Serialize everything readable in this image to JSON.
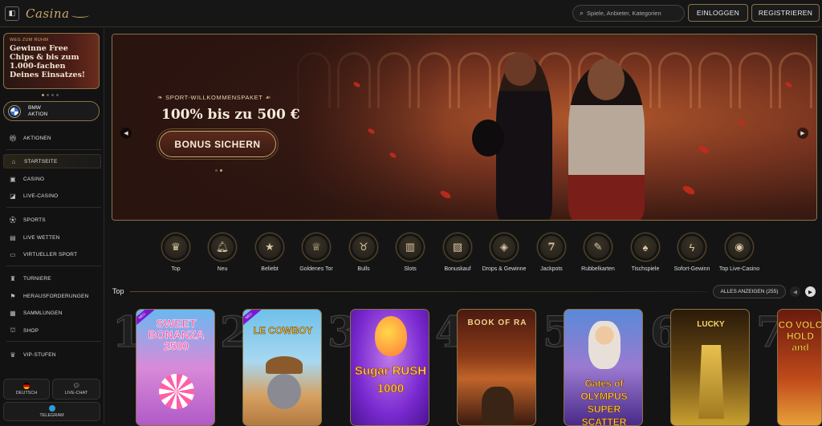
{
  "header": {
    "logo": "Casina",
    "search_placeholder": "Spiele, Anbieter, Kategorien",
    "login_label": "EINLOGGEN",
    "register_label": "REGISTRIEREN"
  },
  "sidebar": {
    "promo": {
      "kicker": "WEG ZUM RUHM",
      "title": "Gewinne Free Chips & bis zum 1.000-fachen Deines Einsatzes!"
    },
    "bmw": {
      "line1": "BMW",
      "line2": "AKTION"
    },
    "items": [
      {
        "label": "AKTIONEN",
        "icon": "gift-icon"
      },
      {
        "label": "STARTSEITE",
        "icon": "home-icon"
      },
      {
        "label": "CASINO",
        "icon": "casino-icon"
      },
      {
        "label": "LIVE-CASINO",
        "icon": "live-casino-icon"
      },
      {
        "label": "SPORTS",
        "icon": "soccer-ball-icon"
      },
      {
        "label": "LIVE WETTEN",
        "icon": "live-bets-icon"
      },
      {
        "label": "VIRTUELLER SPORT",
        "icon": "virtual-sport-icon"
      },
      {
        "label": "TURNIERE",
        "icon": "tournament-icon"
      },
      {
        "label": "HERAUSFORDERUNGEN",
        "icon": "challenge-icon"
      },
      {
        "label": "SAMMLUNGEN",
        "icon": "collection-icon"
      },
      {
        "label": "SHOP",
        "icon": "shop-icon"
      },
      {
        "label": "VIP-STUFEN",
        "icon": "vip-icon"
      }
    ],
    "language_label": "DEUTSCH",
    "chat_label": "LIVE-CHAT",
    "telegram_label": "TELEGRAM"
  },
  "hero": {
    "kicker": "SPORT-WILLKOMMENSPAKET",
    "title": "100% bis zu 500 €",
    "button_label": "BONUS SICHERN"
  },
  "categories": [
    {
      "label": "Top",
      "icon": "crown-icon"
    },
    {
      "label": "Neu",
      "icon": "bell-icon"
    },
    {
      "label": "Beliebt",
      "icon": "star-icon"
    },
    {
      "label": "Goldenes Tor",
      "icon": "trophy-icon"
    },
    {
      "label": "Bulls",
      "icon": "bull-icon"
    },
    {
      "label": "Slots",
      "icon": "slot-machine-icon"
    },
    {
      "label": "Bonuskauf",
      "icon": "bonus-buy-icon"
    },
    {
      "label": "Drops & Gewinne",
      "icon": "drops-wins-icon"
    },
    {
      "label": "Jackpots",
      "icon": "jackpot-icon"
    },
    {
      "label": "Rubbelkarten",
      "icon": "scratch-card-icon"
    },
    {
      "label": "Tischspiele",
      "icon": "cards-icon"
    },
    {
      "label": "Sofort-Gewinn",
      "icon": "lightning-icon"
    },
    {
      "label": "Top Live-Casino",
      "icon": "chip-icon"
    }
  ],
  "top_section": {
    "title": "Top",
    "show_all_label": "ALLES ANZEIGEN (255)"
  },
  "games": [
    {
      "rank": "1",
      "title": "SWEET BONANZA 2500",
      "badge": "NEU"
    },
    {
      "rank": "2",
      "title": "LE COWBOY",
      "badge": "NEU"
    },
    {
      "rank": "3",
      "title": "Sugar RUSH 1000"
    },
    {
      "rank": "4",
      "title": "BOOK OF RA"
    },
    {
      "rank": "5",
      "title": "Gates of OLYMPUS SUPER SCATTER"
    },
    {
      "rank": "6",
      "title": "LUCKY"
    },
    {
      "rank": "7",
      "title": "CO VOLC HOLD and"
    }
  ]
}
